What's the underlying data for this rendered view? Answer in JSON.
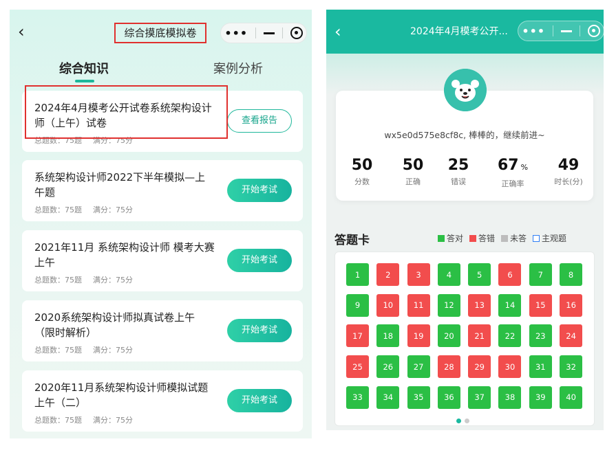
{
  "left": {
    "title": "综合摸底模拟卷",
    "tabs": [
      "综合知识",
      "案例分析"
    ],
    "exams": [
      {
        "title": "2024年4月模考公开试卷系统架构设计师（上午）试卷",
        "total": "总题数：75题",
        "score": "满分：75分",
        "button": "查看报告"
      },
      {
        "title": "系统架构设计师2022下半年模拟—上午题",
        "total": "总题数：75题",
        "score": "满分：75分",
        "button": "开始考试"
      },
      {
        "title": "2021年11月 系统架构设计师 模考大赛 上午",
        "total": "总题数：75题",
        "score": "满分：75分",
        "button": "开始考试"
      },
      {
        "title": "2020系统架构设计师拟真试卷上午（限时解析）",
        "total": "总题数：75题",
        "score": "满分：75分",
        "button": "开始考试"
      },
      {
        "title": "2020年11月系统架构设计师模拟试题上午（二）",
        "total": "总题数：75题",
        "score": "满分：75分",
        "button": "开始考试"
      }
    ]
  },
  "right": {
    "title": "2024年4月模考公开...",
    "user": "wx5e0d575e8cf8c, 棒棒的，继续前进~",
    "stats": [
      {
        "value": "50",
        "unit": "",
        "label": "分数"
      },
      {
        "value": "50",
        "unit": "",
        "label": "正确"
      },
      {
        "value": "25",
        "unit": "",
        "label": "错误"
      },
      {
        "value": "67",
        "unit": "%",
        "label": "正确率"
      },
      {
        "value": "49",
        "unit": "",
        "label": "时长(分)"
      }
    ],
    "answer_card_title": "答题卡",
    "legend": [
      {
        "label": "答对",
        "color": "#2bbf45",
        "hollow": false
      },
      {
        "label": "答错",
        "color": "#f24d4d",
        "hollow": false
      },
      {
        "label": "未答",
        "color": "#bdbdbd",
        "hollow": false
      },
      {
        "label": "主观题",
        "color": "#2f7ff6",
        "hollow": true
      }
    ],
    "questions": [
      {
        "n": "1",
        "status": "correct"
      },
      {
        "n": "2",
        "status": "wrong"
      },
      {
        "n": "3",
        "status": "wrong"
      },
      {
        "n": "4",
        "status": "correct"
      },
      {
        "n": "5",
        "status": "correct"
      },
      {
        "n": "6",
        "status": "wrong"
      },
      {
        "n": "7",
        "status": "correct"
      },
      {
        "n": "8",
        "status": "correct"
      },
      {
        "n": "9",
        "status": "correct"
      },
      {
        "n": "10",
        "status": "wrong"
      },
      {
        "n": "11",
        "status": "wrong"
      },
      {
        "n": "12",
        "status": "correct"
      },
      {
        "n": "13",
        "status": "wrong"
      },
      {
        "n": "14",
        "status": "correct"
      },
      {
        "n": "15",
        "status": "wrong"
      },
      {
        "n": "16",
        "status": "wrong"
      },
      {
        "n": "17",
        "status": "wrong"
      },
      {
        "n": "18",
        "status": "correct"
      },
      {
        "n": "19",
        "status": "wrong"
      },
      {
        "n": "20",
        "status": "correct"
      },
      {
        "n": "21",
        "status": "wrong"
      },
      {
        "n": "22",
        "status": "correct"
      },
      {
        "n": "23",
        "status": "correct"
      },
      {
        "n": "24",
        "status": "wrong"
      },
      {
        "n": "25",
        "status": "wrong"
      },
      {
        "n": "26",
        "status": "correct"
      },
      {
        "n": "27",
        "status": "correct"
      },
      {
        "n": "28",
        "status": "wrong"
      },
      {
        "n": "29",
        "status": "wrong"
      },
      {
        "n": "30",
        "status": "wrong"
      },
      {
        "n": "31",
        "status": "correct"
      },
      {
        "n": "32",
        "status": "correct"
      },
      {
        "n": "33",
        "status": "correct"
      },
      {
        "n": "34",
        "status": "correct"
      },
      {
        "n": "35",
        "status": "correct"
      },
      {
        "n": "36",
        "status": "correct"
      },
      {
        "n": "37",
        "status": "correct"
      },
      {
        "n": "38",
        "status": "correct"
      },
      {
        "n": "39",
        "status": "correct"
      },
      {
        "n": "40",
        "status": "correct"
      }
    ],
    "pager": {
      "pages": 2,
      "active": 1
    }
  },
  "colors": {
    "accent": "#1ab9a0",
    "correct": "#2bbf45",
    "wrong": "#f24d4d",
    "highlight": "#e0302e"
  }
}
